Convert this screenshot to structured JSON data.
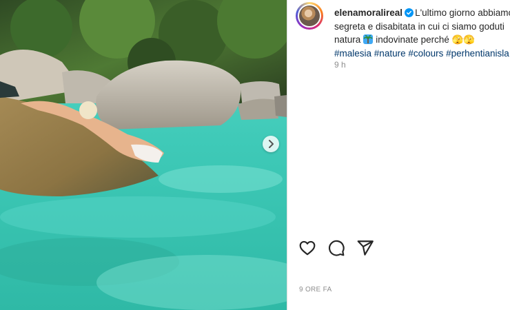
{
  "post": {
    "username": "elenamoralireal",
    "caption_line1": "L'ultimo giorno abbiamo",
    "caption_line2": "segreta e disabitata in cui ci siamo goduti",
    "caption_line3a": "natura",
    "caption_line3b": "indovinate perché 🫣🫣",
    "hashtags": [
      "#malesia",
      "#nature",
      "#colours",
      "#perhentianisla"
    ],
    "caption_time": "9 h",
    "posted_time": "9 ORE FA"
  },
  "icons": {
    "verified": "verified-badge-icon",
    "like": "heart-icon",
    "comment": "comment-icon",
    "share": "share-icon",
    "next": "chevron-right-icon"
  },
  "colors": {
    "verified_blue": "#0095f6",
    "hashtag": "#00376b",
    "muted": "#8e8e8e",
    "text": "#262626"
  }
}
